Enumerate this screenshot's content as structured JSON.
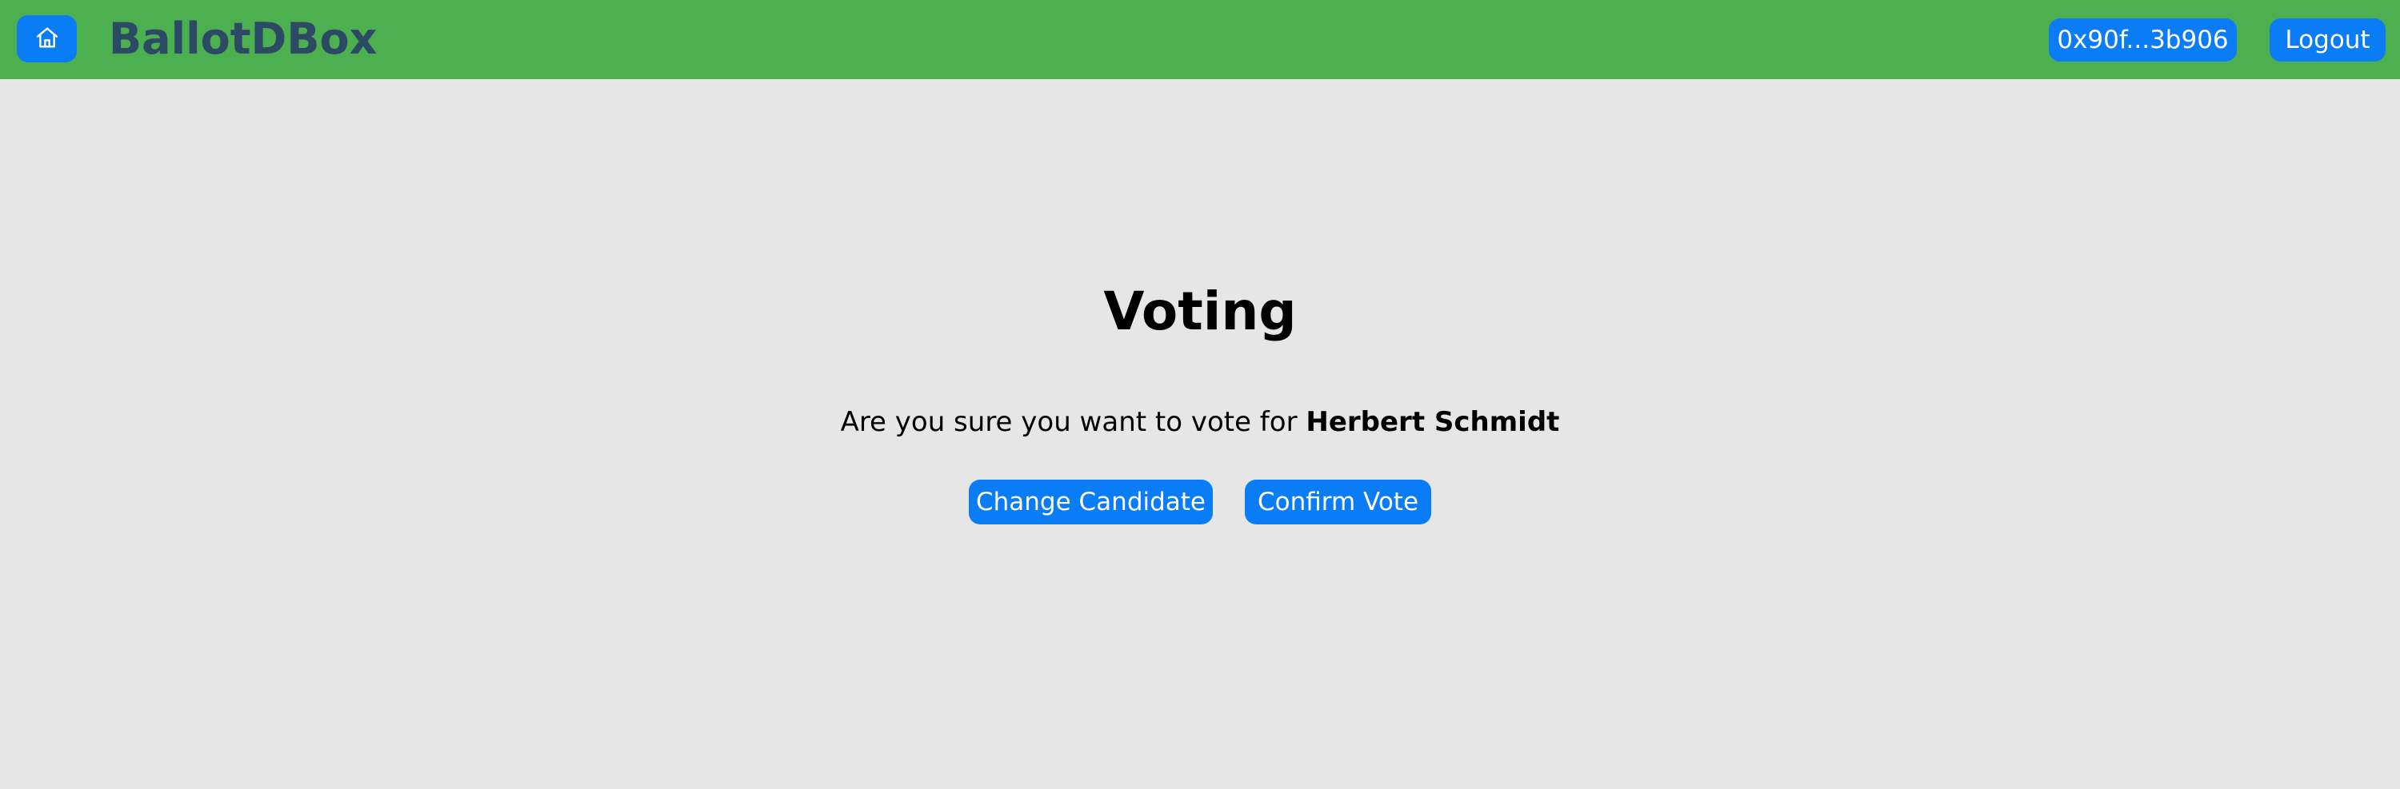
{
  "header": {
    "home_icon": "home-icon",
    "brand": "BallotDBox",
    "wallet_address": "0x90f...3b906",
    "logout_label": "Logout"
  },
  "main": {
    "title": "Voting",
    "question_prefix": "Are you sure you want to vote for ",
    "candidate_name": "Herbert Schmidt",
    "change_candidate_label": "Change Candidate",
    "confirm_vote_label": "Confirm Vote"
  },
  "colors": {
    "navbar": "#4caf50",
    "button": "#0a7cf5",
    "brand_text": "#2c4a63",
    "background": "#e6e6e6"
  }
}
